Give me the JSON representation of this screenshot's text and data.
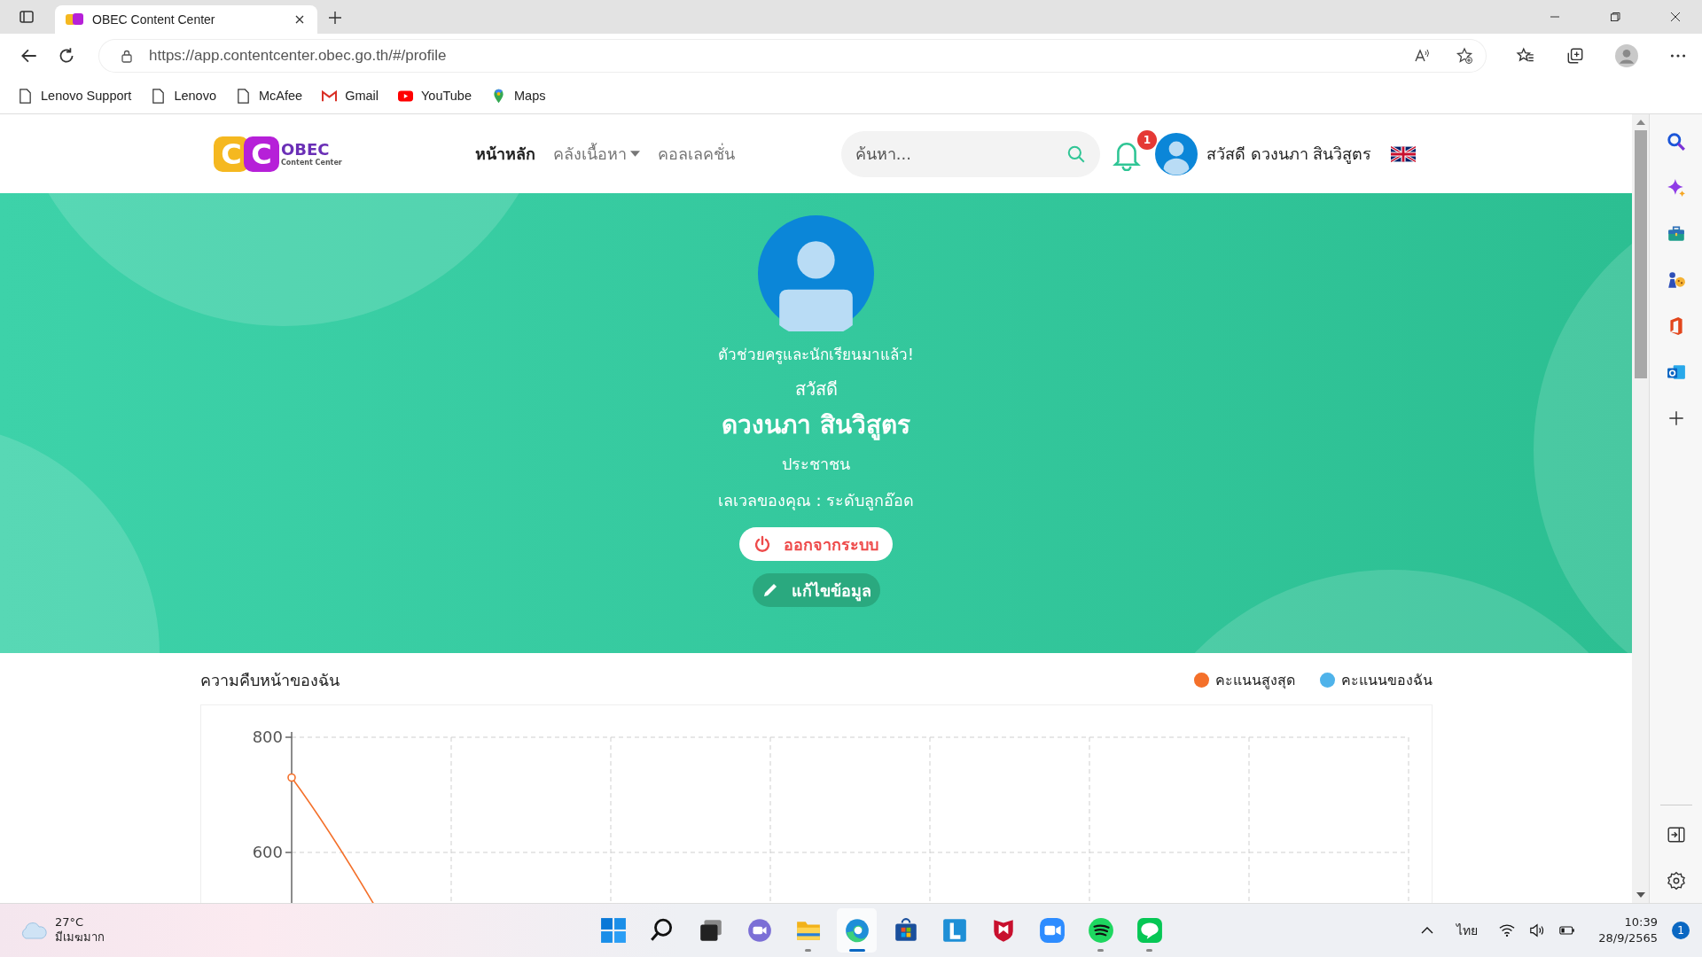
{
  "browser": {
    "tab": {
      "title": "OBEC Content Center"
    },
    "url": "https://app.contentcenter.obec.go.th/#/profile",
    "bookmarks": [
      {
        "label": "Lenovo Support",
        "kind": "page"
      },
      {
        "label": "Lenovo",
        "kind": "page"
      },
      {
        "label": "McAfee",
        "kind": "page"
      },
      {
        "label": "Gmail",
        "kind": "gmail"
      },
      {
        "label": "YouTube",
        "kind": "youtube"
      },
      {
        "label": "Maps",
        "kind": "maps"
      }
    ]
  },
  "header": {
    "logo": {
      "letters": [
        "C",
        "C"
      ],
      "name": "OBEC",
      "tagline": "Content Center"
    },
    "nav": [
      {
        "label": "หน้าหลัก",
        "selected": true,
        "dropdown": false
      },
      {
        "label": "คลังเนื้อหา",
        "selected": false,
        "dropdown": true
      },
      {
        "label": "คอลเลคชั่น",
        "selected": false,
        "dropdown": false
      }
    ],
    "search": {
      "placeholder": "ค้นหา..."
    },
    "notifications": "1",
    "greeting": "สวัสดี ดวงนภา สินวิสูตร"
  },
  "profile": {
    "tagline": "ตัวช่วยครูและนักเรียนมาแล้ว!",
    "hello": "สวัสดี",
    "name": "ดวงนภา สินวิสูตร",
    "role": "ประชาชน",
    "level": "เลเวลของคุณ : ระดับลูกอ๊อด",
    "buttons": [
      {
        "label": "ออกจากระบบ",
        "kind": "logout"
      },
      {
        "label": "แก้ไขข้อมูล",
        "kind": "edit"
      }
    ]
  },
  "progress": {
    "title": "ความคืบหน้าของฉัน",
    "legend": [
      {
        "label": "คะแนนสูงสุด",
        "color": "#f4702a"
      },
      {
        "label": "คะแนนของฉัน",
        "color": "#4fb3ea"
      }
    ],
    "y_axis_labels": [
      "800",
      "600"
    ]
  },
  "taskbar": {
    "weather": {
      "temp": "27°C",
      "condition": "มีเมฆมาก"
    },
    "apps": [
      {
        "kind": "start",
        "running": false,
        "selected": false
      },
      {
        "kind": "search",
        "running": false,
        "selected": false
      },
      {
        "kind": "taskview",
        "running": false,
        "selected": false
      },
      {
        "kind": "chat",
        "running": false,
        "selected": false
      },
      {
        "kind": "explorer",
        "running": true,
        "selected": false
      },
      {
        "kind": "edge",
        "running": true,
        "selected": true
      },
      {
        "kind": "store",
        "running": false,
        "selected": false
      },
      {
        "kind": "lapp",
        "running": false,
        "selected": false
      },
      {
        "kind": "mcafee",
        "running": false,
        "selected": false
      },
      {
        "kind": "zoom",
        "running": false,
        "selected": false
      },
      {
        "kind": "spotify",
        "running": true,
        "selected": false
      },
      {
        "kind": "line",
        "running": true,
        "selected": false
      }
    ],
    "language": "ไทย",
    "time": "10:39",
    "date": "28/9/2565",
    "notifications": "1"
  }
}
